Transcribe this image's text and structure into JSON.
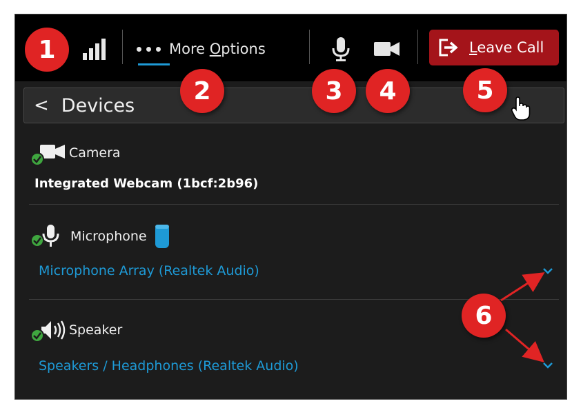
{
  "topbar": {
    "more_options_label_pre": "More ",
    "more_options_label_key": "O",
    "more_options_label_post": "ptions",
    "leave_call_label_key": "L",
    "leave_call_label_rest": "eave Call"
  },
  "devices_header": {
    "back_chevron": "<",
    "title": "Devices"
  },
  "camera": {
    "label": "Camera",
    "value": "Integrated Webcam (1bcf:2b96)"
  },
  "microphone": {
    "label": "Microphone",
    "value": "Microphone Array (Realtek Audio)"
  },
  "speaker": {
    "label": "Speaker",
    "value": "Speakers / Headphones (Realtek Audio)"
  },
  "callouts": [
    "1",
    "2",
    "3",
    "4",
    "5",
    "6"
  ],
  "colors": {
    "accent": "#1e9ad6",
    "leave": "#a4141a",
    "callout": "#e02424",
    "check": "#3fa63f"
  }
}
